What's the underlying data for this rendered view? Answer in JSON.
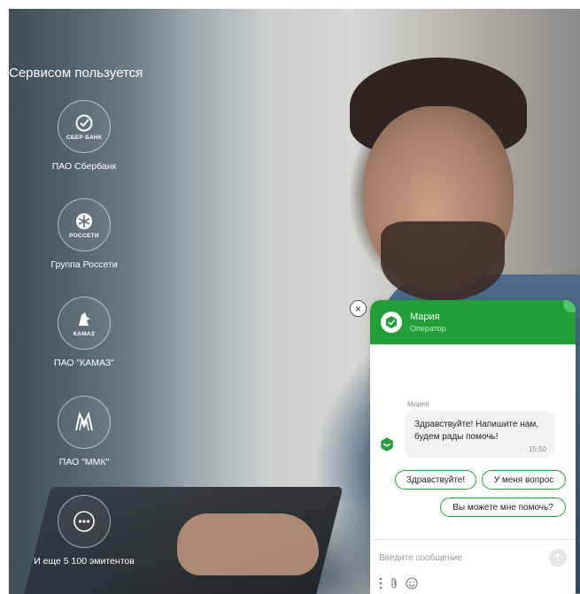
{
  "services": {
    "title": "Сервисом пользуется",
    "items": [
      {
        "label": "ПАО Сбербанк",
        "logo_text": "СБЕР БАНК",
        "icon": "sberbank-logo-icon"
      },
      {
        "label": "Группа Россети",
        "logo_text": "РОССЕТИ",
        "icon": "rosseti-logo-icon"
      },
      {
        "label": "ПАО \"КАМАЗ\"",
        "logo_text": "КАМАЗ",
        "icon": "kamaz-logo-icon"
      },
      {
        "label": "ПАО \"ММК\"",
        "logo_text": "",
        "icon": "mmk-logo-icon"
      },
      {
        "label": "И еще 5 100 эмитентов",
        "logo_text": "",
        "icon": "more-dots-icon"
      }
    ]
  },
  "chat": {
    "operator_name": "Мария",
    "operator_role": "Оператор",
    "message": {
      "sender": "Мария",
      "text": "Здравствуйте! Напишите нам, будем рады помочь!",
      "time": "15:50"
    },
    "quick_replies": [
      "Здравствуйте!",
      "У меня вопрос",
      "Вы можете мне помочь?"
    ],
    "input_placeholder": "Введите сообщение",
    "accent_color": "#21a038"
  }
}
